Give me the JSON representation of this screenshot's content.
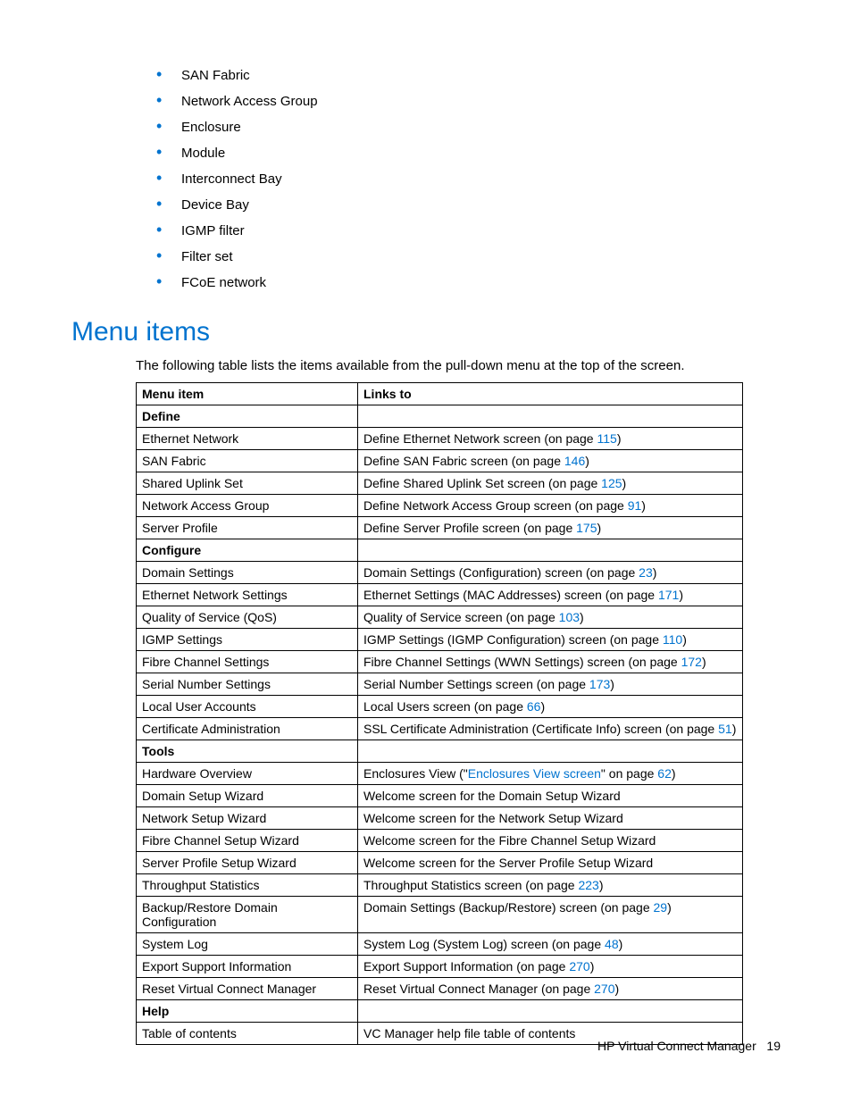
{
  "bullets": [
    "SAN Fabric",
    "Network Access Group",
    "Enclosure",
    "Module",
    "Interconnect Bay",
    "Device Bay",
    "IGMP filter",
    "Filter set",
    "FCoE network"
  ],
  "section_title": "Menu items",
  "intro": "The following table lists the items available from the pull-down menu at the top of the screen.",
  "table": {
    "headers": [
      "Menu item",
      "Links to"
    ],
    "rows": [
      {
        "type": "section",
        "label": "Define"
      },
      {
        "type": "row",
        "item": "Ethernet Network",
        "links": [
          {
            "t": "Define Ethernet Network screen (on page "
          },
          {
            "l": "115"
          },
          {
            "t": ")"
          }
        ]
      },
      {
        "type": "row",
        "item": "SAN Fabric",
        "links": [
          {
            "t": "Define SAN Fabric screen (on page "
          },
          {
            "l": "146"
          },
          {
            "t": ")"
          }
        ]
      },
      {
        "type": "row",
        "item": "Shared Uplink Set",
        "links": [
          {
            "t": "Define Shared Uplink Set screen (on page "
          },
          {
            "l": "125"
          },
          {
            "t": ")"
          }
        ]
      },
      {
        "type": "row",
        "item": "Network Access Group",
        "links": [
          {
            "t": "Define Network Access Group screen (on page "
          },
          {
            "l": "91"
          },
          {
            "t": ")"
          }
        ]
      },
      {
        "type": "row",
        "item": "Server Profile",
        "links": [
          {
            "t": "Define Server Profile screen (on page "
          },
          {
            "l": "175"
          },
          {
            "t": ")"
          }
        ]
      },
      {
        "type": "section",
        "label": "Configure"
      },
      {
        "type": "row",
        "item": "Domain Settings",
        "links": [
          {
            "t": "Domain Settings (Configuration) screen (on page "
          },
          {
            "l": "23"
          },
          {
            "t": ")"
          }
        ]
      },
      {
        "type": "row",
        "item": "Ethernet Network Settings",
        "links": [
          {
            "t": "Ethernet Settings (MAC Addresses) screen (on page "
          },
          {
            "l": "171"
          },
          {
            "t": ")"
          }
        ]
      },
      {
        "type": "row",
        "item": "Quality of Service (QoS)",
        "links": [
          {
            "t": "Quality of Service screen (on page "
          },
          {
            "l": "103"
          },
          {
            "t": ")"
          }
        ]
      },
      {
        "type": "row",
        "item": "IGMP Settings",
        "links": [
          {
            "t": "IGMP Settings (IGMP Configuration) screen (on page "
          },
          {
            "l": "110"
          },
          {
            "t": ")"
          }
        ]
      },
      {
        "type": "row",
        "item": "Fibre Channel Settings",
        "links": [
          {
            "t": "Fibre Channel Settings (WWN Settings) screen (on page "
          },
          {
            "l": "172"
          },
          {
            "t": ")"
          }
        ]
      },
      {
        "type": "row",
        "item": "Serial Number Settings",
        "links": [
          {
            "t": "Serial Number Settings screen (on page "
          },
          {
            "l": "173"
          },
          {
            "t": ")"
          }
        ]
      },
      {
        "type": "row",
        "item": "Local User Accounts",
        "links": [
          {
            "t": "Local Users screen (on page "
          },
          {
            "l": "66"
          },
          {
            "t": ")"
          }
        ]
      },
      {
        "type": "row",
        "item": "Certificate Administration",
        "links": [
          {
            "t": "SSL Certificate Administration (Certificate Info) screen (on page "
          },
          {
            "l": "51"
          },
          {
            "t": ")"
          }
        ]
      },
      {
        "type": "section",
        "label": "Tools"
      },
      {
        "type": "row",
        "item": "Hardware Overview",
        "links": [
          {
            "t": "Enclosures View (\""
          },
          {
            "l": "Enclosures View screen"
          },
          {
            "t": "\" on page "
          },
          {
            "l": "62"
          },
          {
            "t": ")"
          }
        ]
      },
      {
        "type": "row",
        "item": "Domain Setup Wizard",
        "links": [
          {
            "t": "Welcome screen for the Domain Setup Wizard"
          }
        ]
      },
      {
        "type": "row",
        "item": "Network Setup Wizard",
        "links": [
          {
            "t": "Welcome screen for the Network Setup Wizard"
          }
        ]
      },
      {
        "type": "row",
        "item": "Fibre Channel Setup Wizard",
        "links": [
          {
            "t": "Welcome screen for the Fibre Channel Setup Wizard"
          }
        ]
      },
      {
        "type": "row",
        "item": "Server Profile Setup Wizard",
        "links": [
          {
            "t": "Welcome screen for the Server Profile Setup Wizard"
          }
        ]
      },
      {
        "type": "row",
        "item": "Throughput Statistics",
        "links": [
          {
            "t": "Throughput Statistics screen (on page "
          },
          {
            "l": "223"
          },
          {
            "t": ")"
          }
        ]
      },
      {
        "type": "row",
        "item": "Backup/Restore Domain Configuration",
        "links": [
          {
            "t": "Domain Settings (Backup/Restore) screen (on page "
          },
          {
            "l": "29"
          },
          {
            "t": ")"
          }
        ]
      },
      {
        "type": "row",
        "item": "System Log",
        "links": [
          {
            "t": "System Log (System Log) screen (on page "
          },
          {
            "l": "48"
          },
          {
            "t": ")"
          }
        ]
      },
      {
        "type": "row",
        "item": "Export Support Information",
        "links": [
          {
            "t": "Export Support Information (on page "
          },
          {
            "l": "270"
          },
          {
            "t": ")"
          }
        ]
      },
      {
        "type": "row",
        "item": "Reset Virtual Connect Manager",
        "links": [
          {
            "t": "Reset Virtual Connect Manager (on page "
          },
          {
            "l": "270"
          },
          {
            "t": ")"
          }
        ]
      },
      {
        "type": "section",
        "label": "Help"
      },
      {
        "type": "row",
        "item": "Table of contents",
        "links": [
          {
            "t": "VC Manager help file table of contents"
          }
        ]
      }
    ]
  },
  "footer": {
    "text": "HP Virtual Connect Manager",
    "page": "19"
  }
}
